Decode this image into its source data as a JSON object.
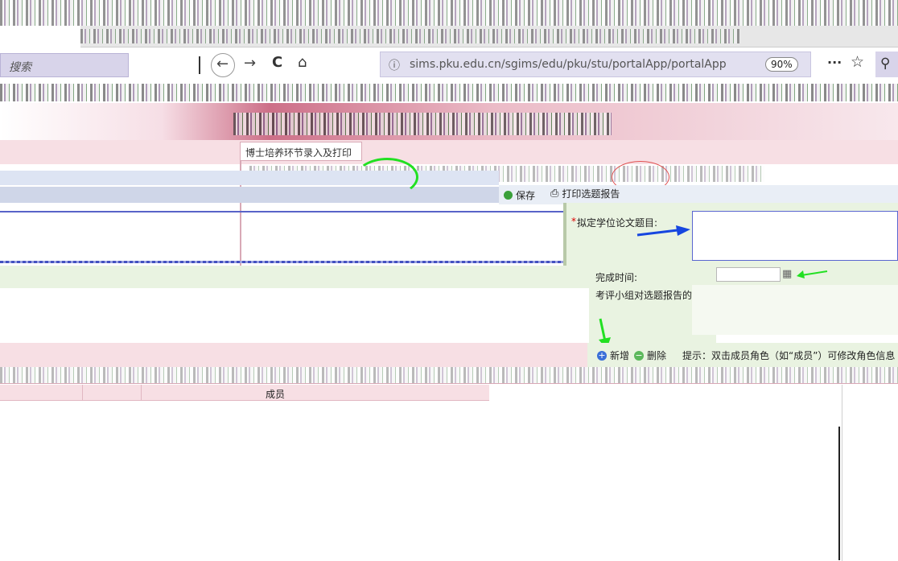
{
  "browser": {
    "window_title": "",
    "search_placeholder": "搜索",
    "url": "sims.pku.edu.cn/sgims/edu/pku/stu/portalApp/portalApp",
    "zoom": "90%",
    "more_label": "···"
  },
  "tabs": {
    "main_tab": "博士培养环节录入及打印"
  },
  "toolbar": {
    "save_label": "保存",
    "print_label": "打印选题报告"
  },
  "form": {
    "thesis_title_required": "*",
    "thesis_title_label": "拟定学位论文题目:",
    "thesis_title_value": "",
    "completion_time_label": "完成时间:",
    "completion_time_value": "",
    "review_opinion_label": "考评小组对选题报告的意见:"
  },
  "members": {
    "add_label": "新增",
    "delete_label": "删除",
    "hint": "提示：双击成员角色（如“成员”）可修改角色信息",
    "row_role": "成员"
  },
  "colors": {
    "pink_band": "#f7dfe4",
    "green_panel": "#e9f3e1",
    "address_bar": "#e2e0f0",
    "blue_arrow": "#1646e0",
    "green_annot": "#22e022",
    "red_annot": "#e05050"
  }
}
